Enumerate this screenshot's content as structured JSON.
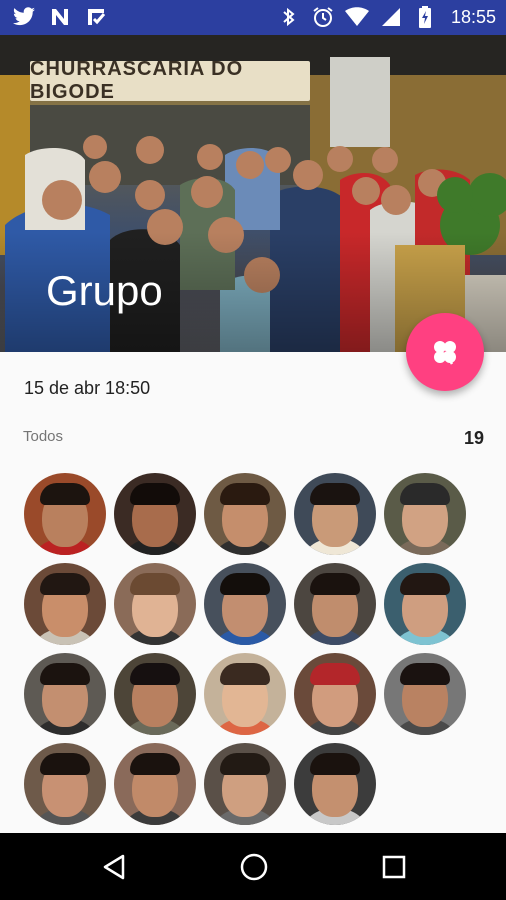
{
  "status_bar": {
    "time": "18:55",
    "left_icons": [
      "twitter-icon",
      "n-app-icon",
      "tasks-app-icon"
    ],
    "right_icons": [
      "bluetooth-icon",
      "alarm-icon",
      "wifi-icon",
      "signal-icon",
      "battery-charging-icon"
    ]
  },
  "header": {
    "title": "Grupo",
    "sign_text": "CHURRASCARIA DO BIGODE"
  },
  "fab": {
    "icon": "clover-icon",
    "color": "#ff4081"
  },
  "event": {
    "datetime": "15 de abr 18:50"
  },
  "members": {
    "label": "Todos",
    "count": "19",
    "avatars": [
      {
        "bg": "#9a4a2a",
        "skin": "#b9805e",
        "hair": "#1c140f",
        "shirt": "#b22"
      },
      {
        "bg": "#3b2b24",
        "skin": "#a86c4c",
        "hair": "#120c09",
        "shirt": "#222"
      },
      {
        "bg": "#6e5a44",
        "skin": "#c58e6c",
        "hair": "#2a1a10",
        "shirt": "#2f2f2f"
      },
      {
        "bg": "#3f4a58",
        "skin": "#c99a78",
        "hair": "#1a1310",
        "shirt": "#efe7d6"
      },
      {
        "bg": "#5a5b48",
        "skin": "#d1a283",
        "hair": "#2a2a2a",
        "shirt": "#7a6a5a"
      },
      {
        "bg": "#6b4a38",
        "skin": "#c98e6a",
        "hair": "#211712",
        "shirt": "#c9c2b5"
      },
      {
        "bg": "#8a6b58",
        "skin": "#e0b394",
        "hair": "#6b4a32",
        "shirt": "#333"
      },
      {
        "bg": "#47505c",
        "skin": "#c28e70",
        "hair": "#130e0b",
        "shirt": "#2a5aa6"
      },
      {
        "bg": "#4c4640",
        "skin": "#c08d6d",
        "hair": "#1a120e",
        "shirt": "#3e4c66"
      },
      {
        "bg": "#3b5f6e",
        "skin": "#cf9e80",
        "hair": "#221712",
        "shirt": "#7ec3d2"
      },
      {
        "bg": "#5e5a54",
        "skin": "#c38f70",
        "hair": "#1b130f",
        "shirt": "#2d2d2d"
      },
      {
        "bg": "#4d4538",
        "skin": "#b88060",
        "hair": "#161010",
        "shirt": "#6a6a5a"
      },
      {
        "bg": "#c4b29a",
        "skin": "#e2b694",
        "hair": "#3a2a20",
        "shirt": "#d64"
      },
      {
        "bg": "#6a4a3a",
        "skin": "#d19c7e",
        "hair": "#b3262a",
        "shirt": "#444"
      },
      {
        "bg": "#777",
        "skin": "#b98262",
        "hair": "#1a1210",
        "shirt": "#4a4a4a"
      },
      {
        "bg": "#6e5a4a",
        "skin": "#c89173",
        "hair": "#1a120e",
        "shirt": "#555"
      },
      {
        "bg": "#8a6a5a",
        "skin": "#c18a69",
        "hair": "#1a120e",
        "shirt": "#3b3b3b"
      },
      {
        "bg": "#5a5048",
        "skin": "#cf9f80",
        "hair": "#221a14",
        "shirt": "#6a6a6a"
      },
      {
        "bg": "#3c3c3c",
        "skin": "#c4906f",
        "hair": "#1a120e",
        "shirt": "#c8c8c8"
      }
    ]
  },
  "nav": {
    "back": "back-icon",
    "home": "home-icon",
    "recents": "recents-icon"
  }
}
